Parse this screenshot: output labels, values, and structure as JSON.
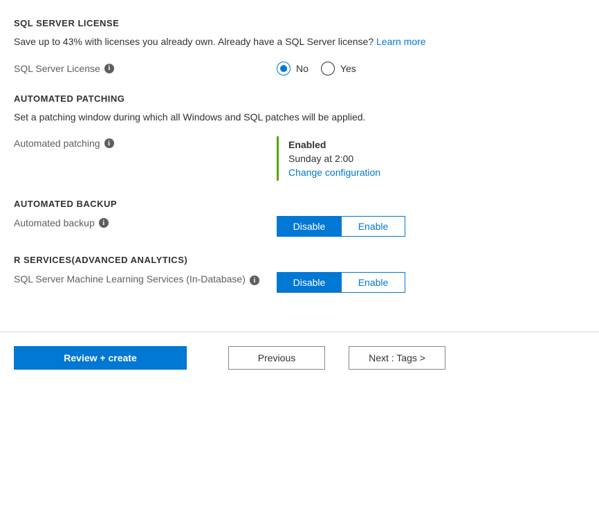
{
  "sections": {
    "license": {
      "header": "SQL SERVER LICENSE",
      "desc": "Save up to 43% with licenses you already own. Already have a SQL Server license? ",
      "learn_more": "Learn more",
      "field_label": "SQL Server License",
      "radio_no": "No",
      "radio_yes": "Yes"
    },
    "patching": {
      "header": "AUTOMATED PATCHING",
      "desc": "Set a patching window during which all Windows and SQL patches will be applied.",
      "field_label": "Automated patching",
      "status_title": "Enabled",
      "status_sub": "Sunday at 2:00",
      "status_link": "Change configuration"
    },
    "backup": {
      "header": "AUTOMATED BACKUP",
      "field_label": "Automated backup",
      "disable": "Disable",
      "enable": "Enable"
    },
    "rservices": {
      "header": "R SERVICES(ADVANCED ANALYTICS)",
      "field_label": "SQL Server Machine Learning Services (In-Database)",
      "disable": "Disable",
      "enable": "Enable"
    }
  },
  "footer": {
    "review": "Review + create",
    "previous": "Previous",
    "next": "Next : Tags >"
  }
}
